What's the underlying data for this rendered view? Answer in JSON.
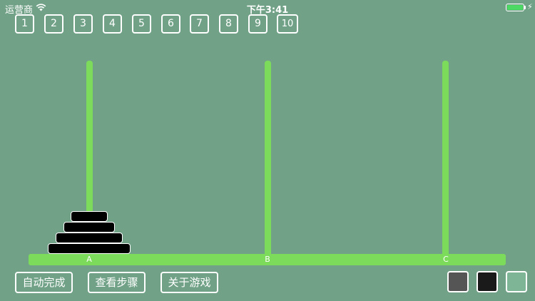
{
  "status_bar": {
    "carrier": "运营商",
    "time": "下午3:41",
    "battery_color": "#4cd964"
  },
  "levels": [
    "1",
    "2",
    "3",
    "4",
    "5",
    "6",
    "7",
    "8",
    "9",
    "10"
  ],
  "pegs": [
    "A",
    "B",
    "C"
  ],
  "disks_on_peg_a": 4,
  "actions": {
    "auto_complete": "自动完成",
    "view_steps": "查看步骤",
    "about_game": "关于游戏"
  },
  "theme_swatches": [
    "#555555",
    "#1a1a1a",
    "#7fb597"
  ],
  "colors": {
    "background": "#71a287",
    "peg": "#7ddb5c",
    "disk": "#000000"
  }
}
